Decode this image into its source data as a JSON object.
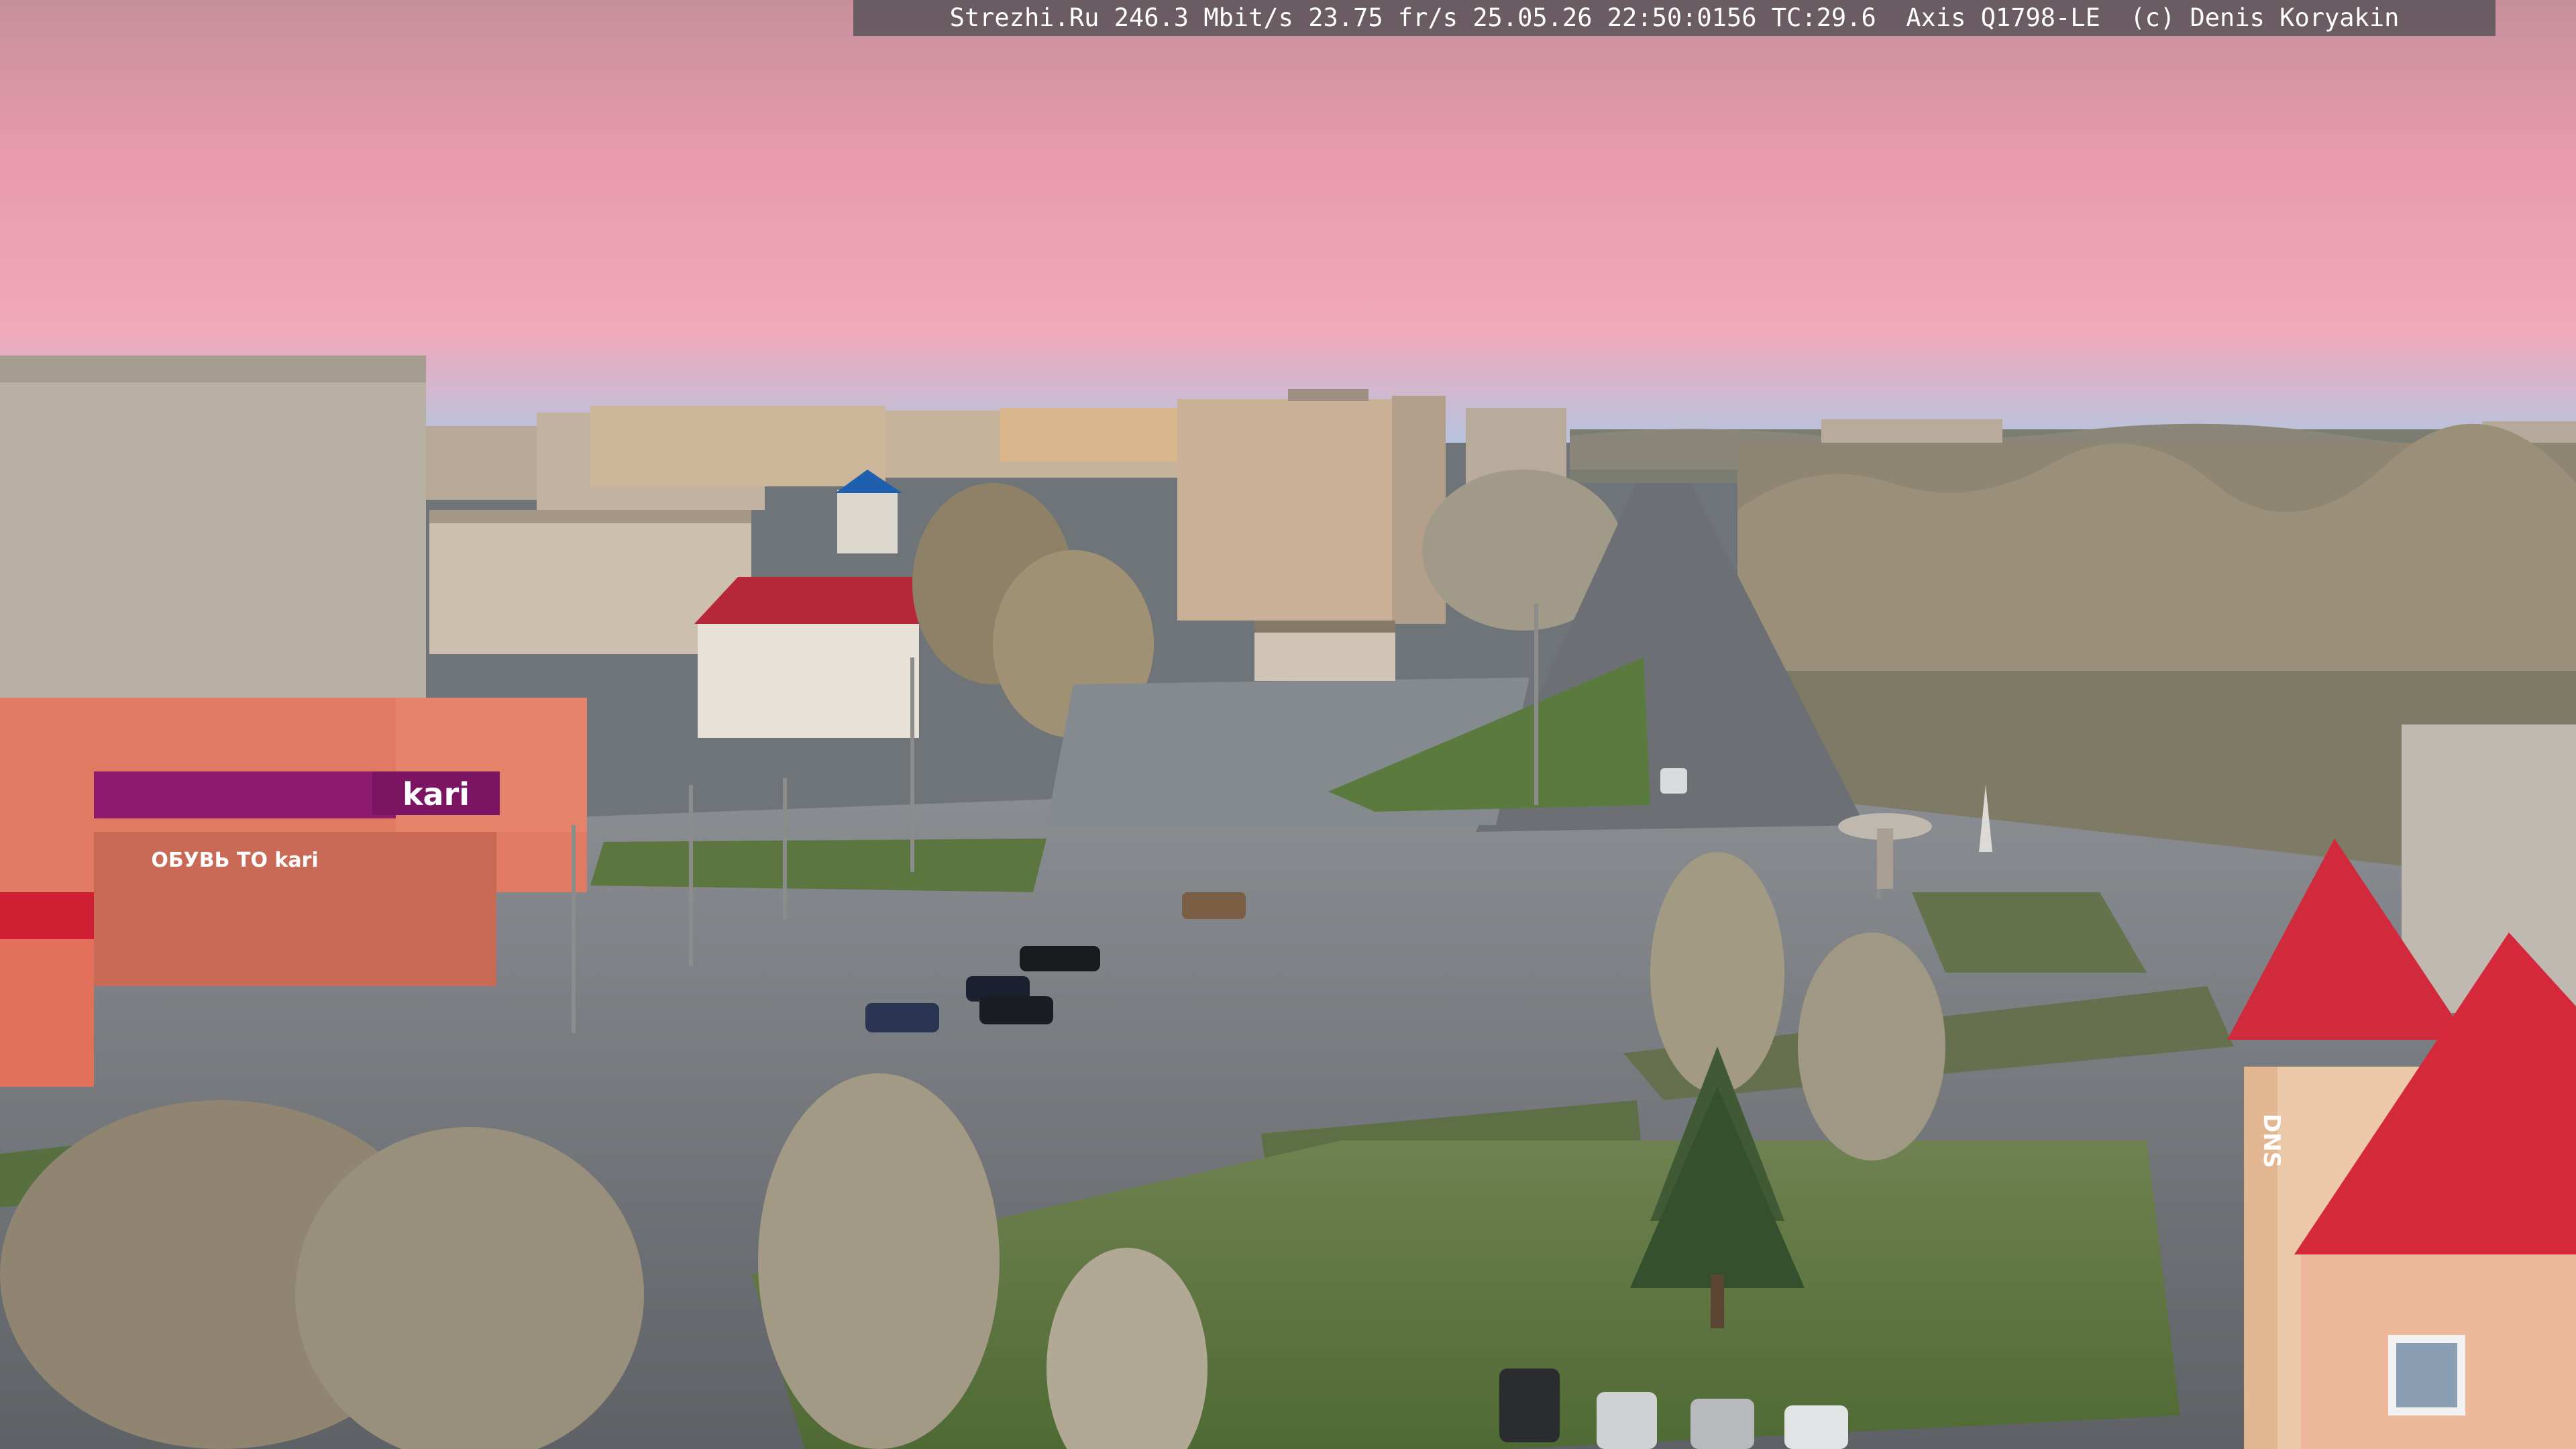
{
  "overlay": {
    "caption": "Strezhi.Ru 246.3 Mbit/s 23.75 fr/s 25.05.26 22:50:0156 TC:29.6  Axis Q1798-LE  (c) Denis Koryakin"
  },
  "signs": {
    "kari_shop": "kari",
    "kari_banner": "ОБУВЬ ТО kari",
    "dns_store": "DNS"
  },
  "colors": {
    "sky_top": "#d89aa8",
    "sky_mid": "#f0a7b8",
    "sky_horizon": "#a9c2e0",
    "asphalt": "#6e7276",
    "roof_red": "#d12a3c",
    "kari_purple": "#8e1b6e"
  }
}
